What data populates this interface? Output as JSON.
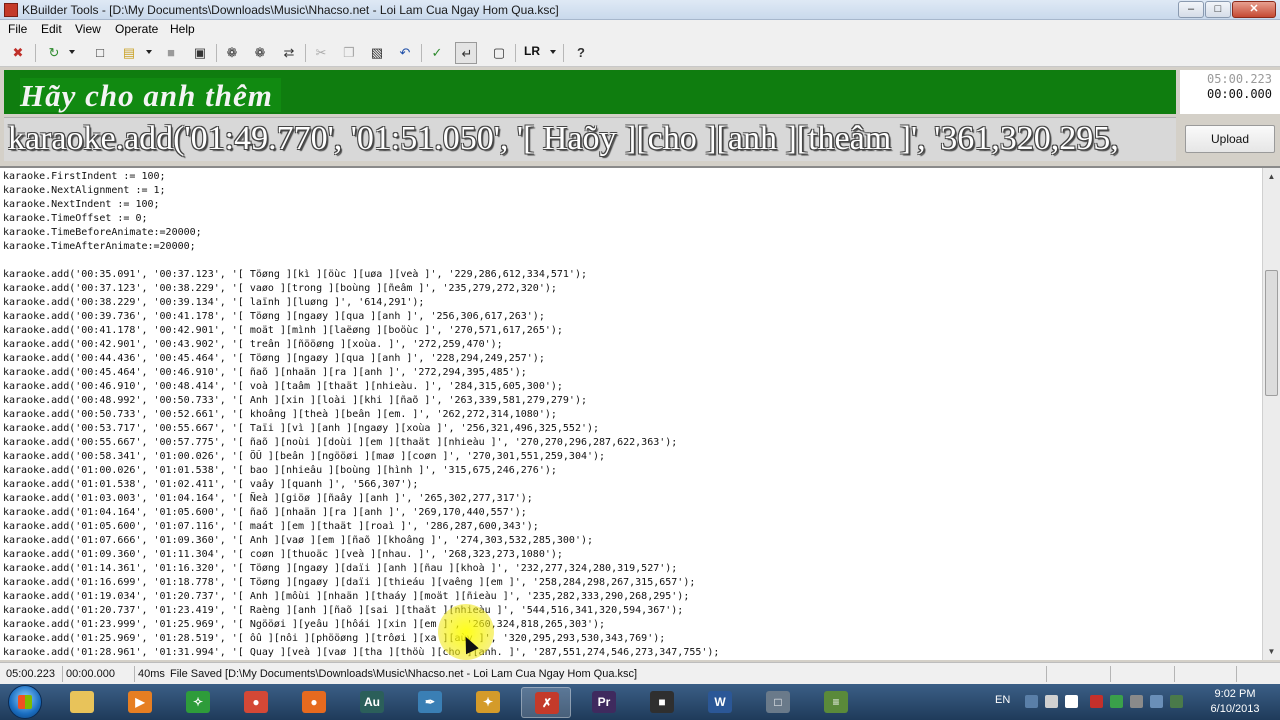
{
  "window": {
    "title": "KBuilder Tools - [D:\\My Documents\\Downloads\\Music\\Nhacso.net - Loi Lam Cua Ngay Hom Qua.ksc]",
    "min_glyph": "–",
    "max_glyph": "□",
    "close_glyph": "✕"
  },
  "menu": {
    "items": [
      "File",
      "Edit",
      "View",
      "Operate",
      "Help"
    ]
  },
  "toolbar": {
    "icons": [
      "exit-icon",
      "refresh-icon",
      "new-file-icon",
      "open-folder-icon",
      "save-icon",
      "save-all-icon",
      "find-icon",
      "find-next-icon",
      "replace-icon",
      "cut-icon",
      "copy-icon",
      "paste-icon",
      "undo-icon",
      "run-icon",
      "crlf-icon",
      "preview-icon",
      "help-icon"
    ],
    "glyphs": [
      "✖",
      "↻",
      "□",
      "▤",
      "■",
      "▣",
      "❁",
      "❁",
      "⇄",
      "✂",
      "❐",
      "▧",
      "↶",
      "✓",
      "↵",
      "▢",
      "?"
    ],
    "lr_label": "LR"
  },
  "lyric_preview": {
    "highlighted_text": "Hãy cho anh thêm",
    "time_total": "05:00.223",
    "time_current": "00:00.000"
  },
  "preview_line": {
    "text": "karaoke.add('01:49.770', '01:51.050', '[ Haõy ][cho ][anh ][theâm ]', '361,320,295,"
  },
  "upload_button": {
    "label": "Upload"
  },
  "editor": {
    "lines": [
      "karaoke.FirstIndent := 100;",
      "karaoke.NextAlignment := 1;",
      "karaoke.NextIndent := 100;",
      "karaoke.TimeOffset := 0;",
      "karaoke.TimeBeforeAnimate:=20000;",
      "karaoke.TimeAfterAnimate:=20000;",
      "",
      "karaoke.add('00:35.091', '00:37.123', '[ Töøng ][kì ][öùc ][uøa ][veà ]', '229,286,612,334,571');",
      "karaoke.add('00:37.123', '00:38.229', '[ vaøo ][trong ][boùng ][ñeâm ]', '235,279,272,320');",
      "karaoke.add('00:38.229', '00:39.134', '[ laïnh ][luøng ]', '614,291');",
      "karaoke.add('00:39.736', '00:41.178', '[ Töøng ][ngaøy ][qua ][anh ]', '256,306,617,263');",
      "karaoke.add('00:41.178', '00:42.901', '[ moät ][mình ][laëøng ][boöùc ]', '270,571,617,265');",
      "karaoke.add('00:42.901', '00:43.902', '[ treân ][ñööøng ][xoùa. ]', '272,259,470');",
      "karaoke.add('00:44.436', '00:45.464', '[ Töøng ][ngaøy ][qua ][anh ]', '228,294,249,257');",
      "karaoke.add('00:45.464', '00:46.910', '[ ñaõ ][nhaän ][ra ][anh ]', '272,294,395,485');",
      "karaoke.add('00:46.910', '00:48.414', '[ voà ][taâm ][thaät ][nhieàu. ]', '284,315,605,300');",
      "karaoke.add('00:48.992', '00:50.733', '[ Anh ][xin ][loài ][khi ][ñaõ ]', '263,339,581,279,279');",
      "karaoke.add('00:50.733', '00:52.661', '[ khoâng ][theà ][beân ][em. ]', '262,272,314,1080');",
      "karaoke.add('00:53.717', '00:55.667', '[ Taïi ][vì ][anh ][ngaøy ][xoùa ]', '256,321,496,325,552');",
      "karaoke.add('00:55.667', '00:57.775', '[ ñaõ ][noùi ][doùi ][em ][thaät ][nhieàu ]', '270,270,296,287,622,363');",
      "karaoke.add('00:58.341', '01:00.026', '[ ÖÛ ][beân ][ngööøi ][maø ][coøn ]', '270,301,551,259,304');",
      "karaoke.add('01:00.026', '01:01.538', '[ bao ][nhieâu ][boùng ][hình ]', '315,675,246,276');",
      "karaoke.add('01:01.538', '01:02.411', '[ vaây ][quanh ]', '566,307');",
      "karaoke.add('01:03.003', '01:04.164', '[ Ñeà ][giöø ][ñaây ][anh ]', '265,302,277,317');",
      "karaoke.add('01:04.164', '01:05.600', '[ ñaõ ][nhaän ][ra ][anh ]', '269,170,440,557');",
      "karaoke.add('01:05.600', '01:07.116', '[ maát ][em ][thaät ][roaì ]', '286,287,600,343');",
      "karaoke.add('01:07.666', '01:09.360', '[ Anh ][vaø ][em ][ñaõ ][khoâng ]', '274,303,532,285,300');",
      "karaoke.add('01:09.360', '01:11.304', '[ coøn ][thuoäc ][veà ][nhau. ]', '268,323,273,1080');",
      "karaoke.add('01:14.361', '01:16.320', '[ Töøng ][ngaøy ][daïi ][anh ][ñau ][khoà ]', '232,277,324,280,319,527');",
      "karaoke.add('01:16.699', '01:18.778', '[ Töøng ][ngaøy ][daïi ][thieáu ][vaêng ][em ]', '258,284,298,267,315,657');",
      "karaoke.add('01:19.034', '01:20.737', '[ Anh ][môùi ][nhaän ][thaáy ][moät ][ñieàu ]', '235,282,333,290,268,295');",
      "karaoke.add('01:20.737', '01:23.419', '[ Raèng ][anh ][ñaõ ][sai ][thaät ][nhieàu ]', '544,516,341,320,594,367');",
      "karaoke.add('01:23.999', '01:25.969', '[ Ngööøi ][yeâu ][hôái ][xin ][em ]', '260,324,818,265,303');",
      "karaoke.add('01:25.969', '01:28.519', '[ ôû ][nôi ][phööøng ][trôøi ][xa ][aùy ]', '320,295,293,530,343,769');",
      "karaoke.add('01:28.961', '01:31.994', '[ Quay ][veà ][vaø ][tha ][thöù ][cho ][anh. ]', '287,551,274,546,273,347,755');"
    ]
  },
  "statusbar": {
    "total_time": "05:00.223",
    "current_time": "00:00.000",
    "interval": "40ms",
    "message": "File Saved [D:\\My Documents\\Downloads\\Music\\Nhacso.net - Loi Lam Cua Ngay Hom Qua.ksc]"
  },
  "taskbar": {
    "apps": [
      {
        "icon": "windows-explorer-icon",
        "glyph": "",
        "color": "#e8c35a"
      },
      {
        "icon": "media-player-icon",
        "glyph": "▶",
        "color": "#e67e22"
      },
      {
        "icon": "green-app-icon",
        "glyph": "✧",
        "color": "#2e9c3a"
      },
      {
        "icon": "chrome-icon",
        "glyph": "●",
        "color": "#d44836"
      },
      {
        "icon": "firefox-icon",
        "glyph": "●",
        "color": "#e66a1f"
      },
      {
        "icon": "audition-icon",
        "glyph": "Au",
        "color": "#2b5f5a"
      },
      {
        "icon": "pen-tool-icon",
        "glyph": "✒",
        "color": "#3a7fb5"
      },
      {
        "icon": "lyrics-app-icon",
        "glyph": "✦",
        "color": "#d49b2a"
      },
      {
        "icon": "kbuilder-icon",
        "glyph": "✗",
        "color": "#c43a2a"
      },
      {
        "icon": "premiere-icon",
        "glyph": "Pr",
        "color": "#3f2a5e"
      },
      {
        "icon": "console-icon",
        "glyph": "■",
        "color": "#2f2f2f"
      },
      {
        "icon": "word-icon",
        "glyph": "W",
        "color": "#2b5797"
      },
      {
        "icon": "window-icon",
        "glyph": "□",
        "color": "#6a7a8a"
      },
      {
        "icon": "chart-app-icon",
        "glyph": "≡",
        "color": "#5a8a3a"
      }
    ],
    "language": "EN",
    "clock_time": "9:02 PM",
    "clock_date": "6/10/2013"
  }
}
